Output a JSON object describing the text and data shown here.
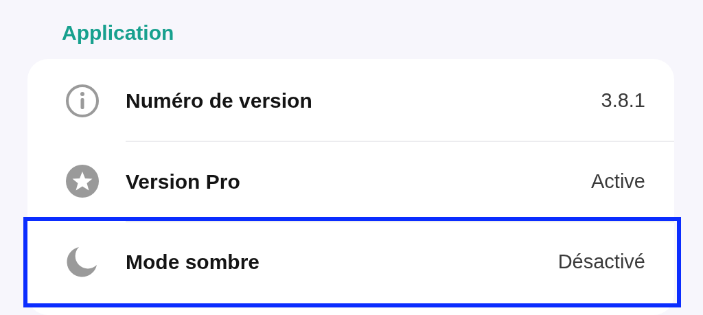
{
  "section": {
    "title": "Application"
  },
  "rows": [
    {
      "kind": "info",
      "label": "Numéro de version",
      "value": "3.8.1",
      "highlighted": false
    },
    {
      "kind": "star",
      "label": "Version Pro",
      "value": "Active",
      "highlighted": false
    },
    {
      "kind": "moon",
      "label": "Mode sombre",
      "value": "Désactivé",
      "highlighted": true
    }
  ]
}
